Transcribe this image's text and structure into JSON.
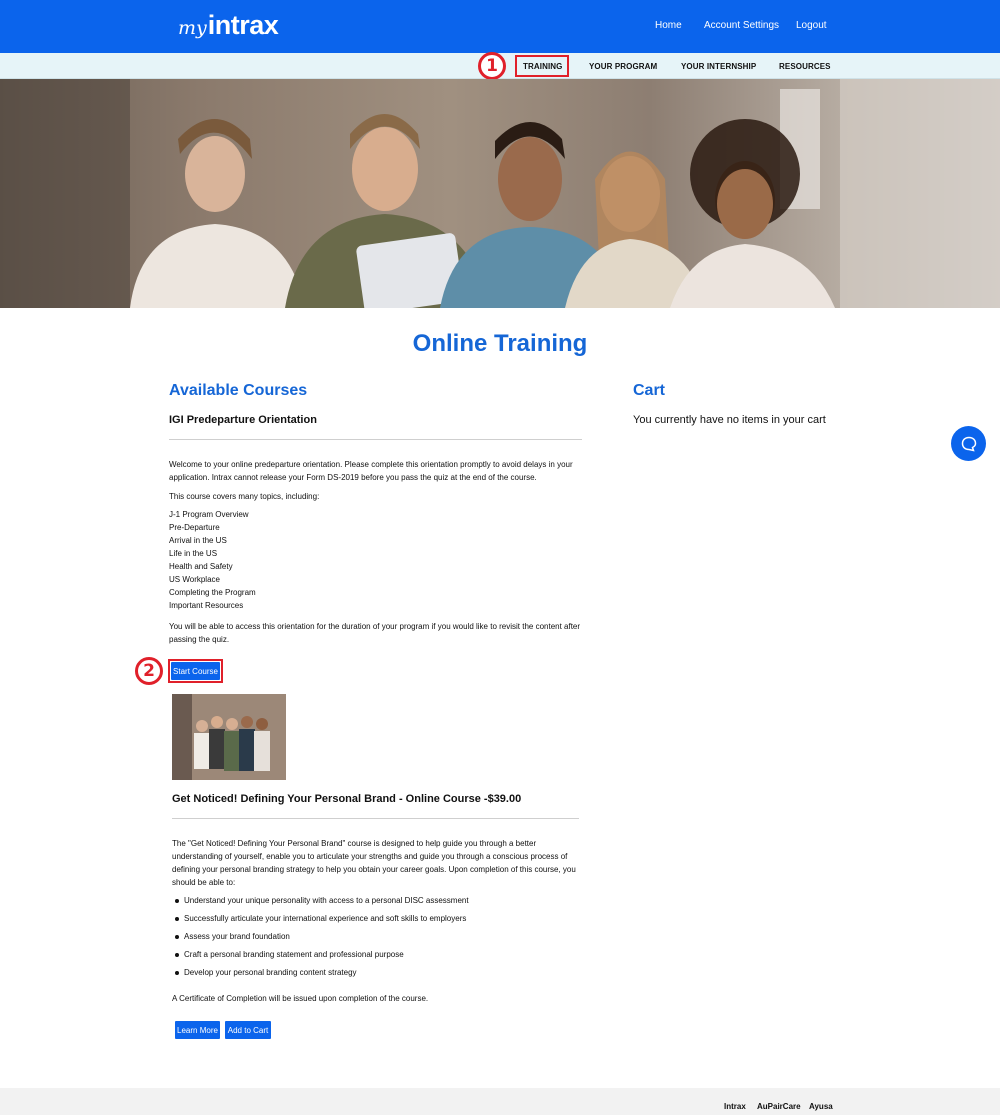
{
  "header": {
    "logo_prefix": "my",
    "logo_brand": "intrax",
    "nav": [
      "Home",
      "Account Settings",
      "Logout"
    ]
  },
  "subnav": [
    "TRAINING",
    "YOUR PROGRAM",
    "YOUR INTERNSHIP",
    "RESOURCES"
  ],
  "markers": [
    "1",
    "2"
  ],
  "page_title": "Online Training",
  "courses": {
    "heading": "Available Courses",
    "course1": {
      "title": "IGI Predeparture Orientation",
      "intro": "Welcome to your online predeparture orientation. Please complete this orientation promptly to avoid delays in your application. Intrax cannot release your Form DS-2019 before you pass the quiz at the end of the course.",
      "topics_intro": "This course covers many topics, including:",
      "topics": [
        "J-1 Program Overview",
        "Pre-Departure",
        "Arrival in the US",
        "Life in the US",
        "Health and Safety",
        "US Workplace",
        "Completing the Program",
        "Important Resources"
      ],
      "access_note": "You will be able to access this orientation for the duration of your program if you would like to revisit the content after passing the quiz.",
      "start_label": "Start Course"
    },
    "course2": {
      "title": "Get Noticed! Defining Your Personal Brand - Online Course -$39.00",
      "description": "The \"Get Noticed! Defining Your Personal Brand\" course is designed to help guide you through a better understanding of yourself, enable you to articulate your strengths and guide you through a conscious process of defining your personal branding strategy to help you obtain your career goals. Upon completion of this course, you should be able to:",
      "bullets": [
        "Understand your unique personality with access to a personal DISC assessment",
        "Successfully articulate your international experience and soft skills to employers",
        "Assess your brand foundation",
        "Craft a personal branding statement and professional purpose",
        "Develop your personal branding content strategy"
      ],
      "certificate": "A Certificate of Completion will be issued upon completion of the course.",
      "learn_more_label": "Learn More",
      "add_to_cart_label": "Add to Cart"
    }
  },
  "cart": {
    "heading": "Cart",
    "empty_message": "You currently have no items in your cart"
  },
  "footer": [
    "Intrax",
    "AuPairCare",
    "Ayusa"
  ],
  "colors": {
    "brand_blue": "#0b64ec",
    "heading_blue": "#1566d6",
    "highlight_red": "#e0202a"
  }
}
